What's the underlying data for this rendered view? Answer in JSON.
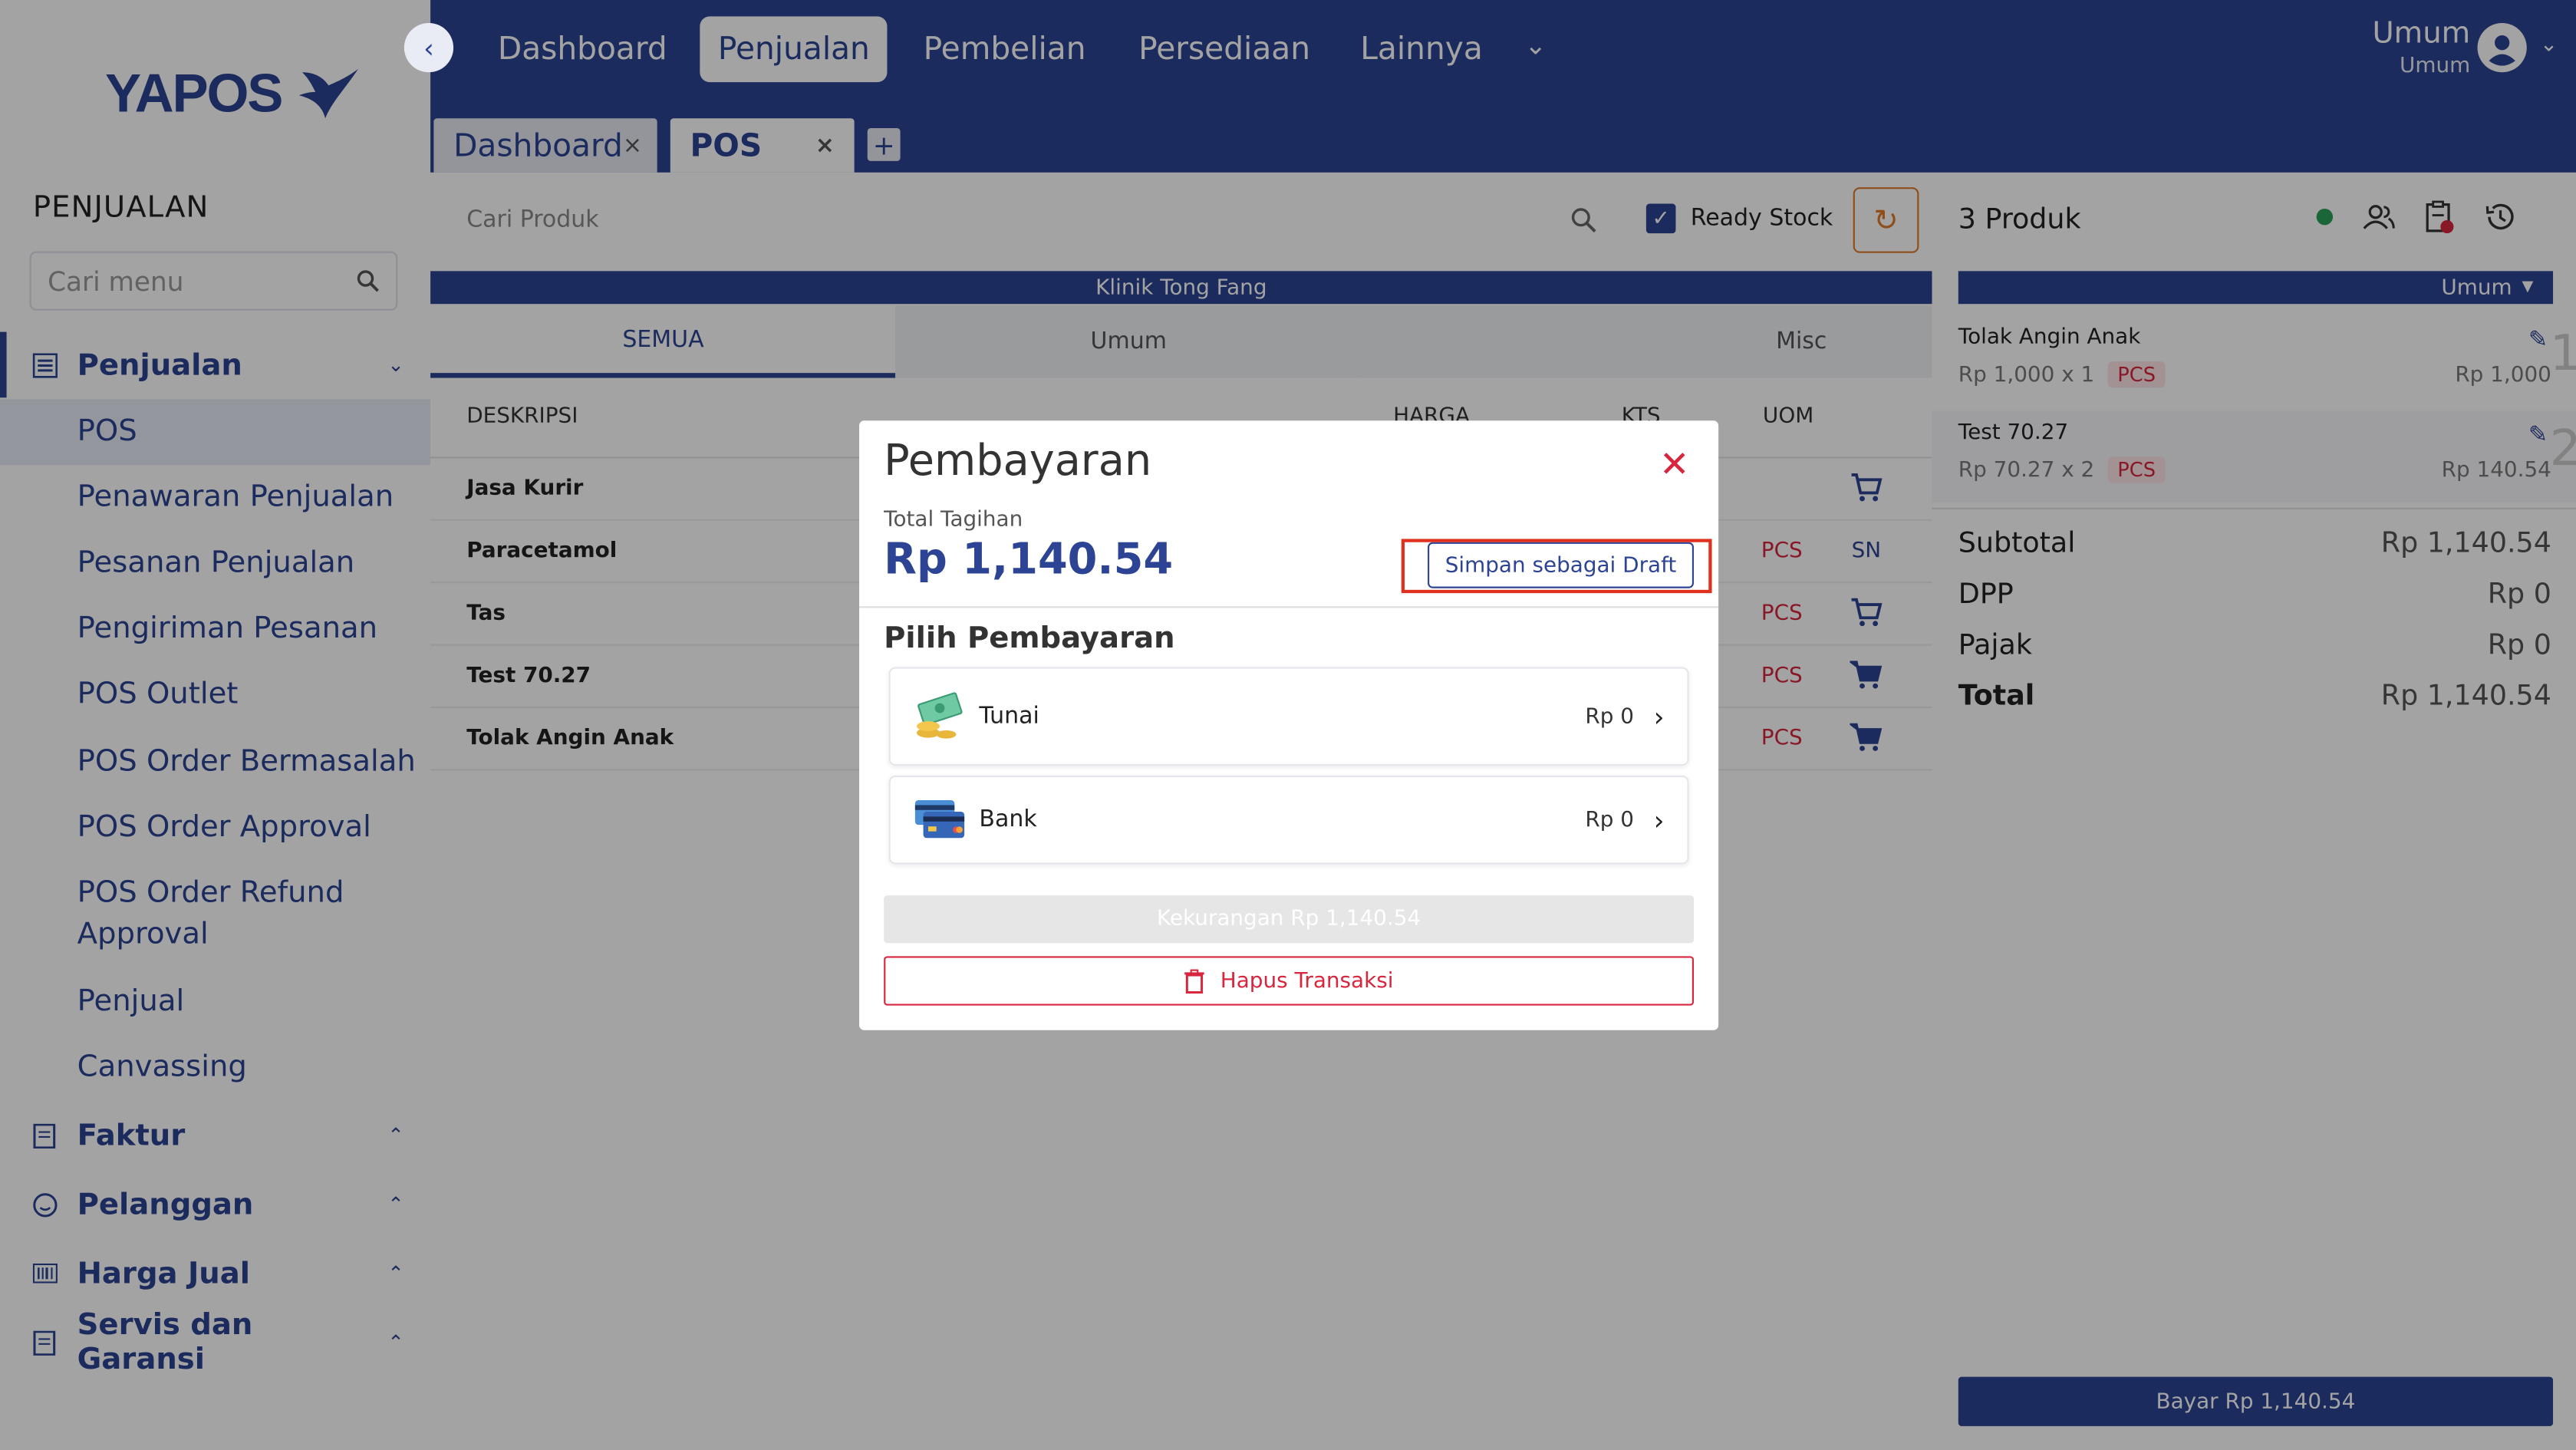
{
  "app": {
    "logo_text": "YAPOS"
  },
  "sidebar": {
    "section_title": "PENJUALAN",
    "search_placeholder": "Cari menu",
    "groups": [
      {
        "label": "Penjualan",
        "icon": "list-icon"
      },
      {
        "label": "Faktur",
        "icon": "receipt-icon"
      },
      {
        "label": "Pelanggan",
        "icon": "smile-icon"
      },
      {
        "label": "Harga Jual",
        "icon": "barcode-icon"
      },
      {
        "label": "Servis dan Garansi",
        "icon": "receipt-icon"
      }
    ],
    "items": [
      "POS",
      "Penawaran Penjualan",
      "Pesanan Penjualan",
      "Pengiriman Pesanan",
      "POS Outlet",
      "POS Order Bermasalah",
      "POS Order Approval",
      "POS Order Refund Approval",
      "Penjual",
      "Canvassing"
    ]
  },
  "topnav": {
    "items": [
      "Dashboard",
      "Penjualan",
      "Pembelian",
      "Persediaan",
      "Lainnya"
    ],
    "active": "Penjualan",
    "user_name": "Umum",
    "user_role": "Umum"
  },
  "tabs": [
    {
      "label": "Dashboard",
      "close": "×"
    },
    {
      "label": "POS",
      "close": "×"
    }
  ],
  "tab_add": "+",
  "pos": {
    "search_placeholder": "Cari Produk",
    "ready_stock_label": "Ready Stock",
    "ready_stock_checked": true,
    "store_name": "Klinik Tong Fang",
    "category_tabs": [
      "SEMUA",
      "Umum",
      "Misc"
    ],
    "columns": [
      "DESKRIPSI",
      "HARGA",
      "KTS",
      "UOM"
    ],
    "products": [
      {
        "name": "Jasa Kurir",
        "uom": "",
        "sn": ""
      },
      {
        "name": "Paracetamol",
        "uom": "PCS",
        "sn": "SN"
      },
      {
        "name": "Tas",
        "uom": "PCS",
        "sn": ""
      },
      {
        "name": "Test 70.27",
        "uom": "PCS",
        "sn": ""
      },
      {
        "name": "Tolak Angin Anak",
        "uom": "PCS",
        "sn": ""
      }
    ]
  },
  "cart": {
    "title": "3 Produk",
    "customer": "Umum",
    "items": [
      {
        "name": "Tolak Angin Anak",
        "qty_price": "Rp 1,000 x 1",
        "uom": "PCS",
        "total": "Rp 1,000",
        "index": "1"
      },
      {
        "name": "Test 70.27",
        "qty_price": "Rp 70.27 x 2",
        "uom": "PCS",
        "total": "Rp 140.54",
        "index": "2"
      }
    ],
    "summary": [
      {
        "label": "Subtotal",
        "value": "Rp 1,140.54"
      },
      {
        "label": "DPP",
        "value": "Rp 0"
      },
      {
        "label": "Pajak",
        "value": "Rp 0"
      },
      {
        "label": "Total",
        "value": "Rp 1,140.54"
      }
    ],
    "pay_button": "Bayar Rp 1,140.54"
  },
  "modal": {
    "title": "Pembayaran",
    "total_label": "Total Tagihan",
    "total_value": "Rp 1,140.54",
    "draft_button": "Simpan sebagai Draft",
    "choose_label": "Pilih Pembayaran",
    "options": [
      {
        "label": "Tunai",
        "value": "Rp 0",
        "icon": "cash-icon"
      },
      {
        "label": "Bank",
        "value": "Rp 0",
        "icon": "card-icon"
      }
    ],
    "shortage_button": "Kekurangan Rp 1,140.54",
    "delete_button": "Hapus Transaksi"
  },
  "colors": {
    "primary": "#2d4494",
    "danger": "#d7263d",
    "highlight": "#e0301e",
    "accent": "#e07a2a"
  }
}
